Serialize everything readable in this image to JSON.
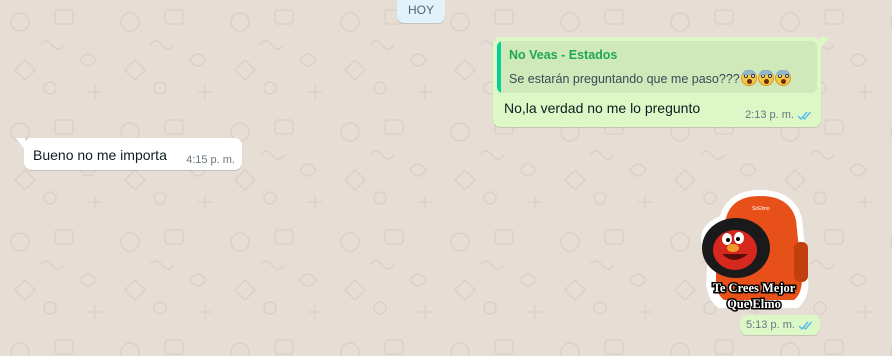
{
  "chat": {
    "date_chip": "HOY",
    "messages": [
      {
        "direction": "outgoing",
        "quote": {
          "author": "No Veas - Estados",
          "text": "Se estarán preguntando que me paso???",
          "emojis": [
            "face-screaming-in-fear",
            "face-screaming-in-fear",
            "face-screaming-in-fear"
          ]
        },
        "text": "No,la verdad no me lo pregunto",
        "time": "2:13 p. m.",
        "status": "read"
      },
      {
        "direction": "incoming",
        "text": "Bueno no me importa",
        "time": "4:15 p. m."
      },
      {
        "direction": "outgoing",
        "type": "sticker",
        "sticker": {
          "caption_line1": "Te Crees Mejor",
          "caption_line2": "Que Elmo",
          "small_text": "SirElmo"
        },
        "time": "5:13 p. m.",
        "status": "read"
      }
    ]
  },
  "colors": {
    "outgoing_bubble": "#dcf8c6",
    "incoming_bubble": "#ffffff",
    "read_ticks": "#53bdeb",
    "quote_author": "#1fa855",
    "quote_bar": "#06cf9c",
    "wallpaper": "#e6ddd4"
  }
}
